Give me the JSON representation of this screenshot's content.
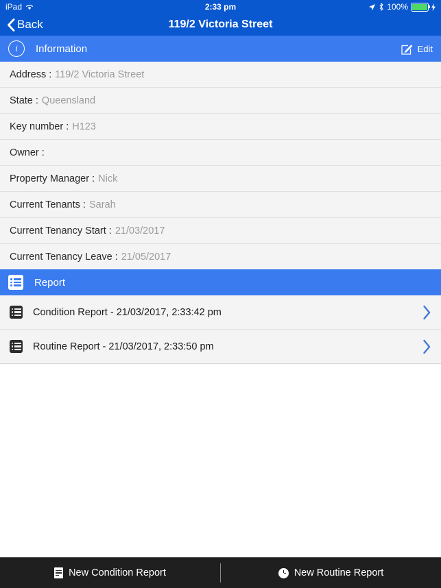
{
  "status_bar": {
    "device": "iPad",
    "wifi_icon": "wifi-icon",
    "time": "2:33 pm",
    "location_icon": "location-arrow-icon",
    "bluetooth_icon": "bluetooth-icon",
    "battery_percent": "100%",
    "battery_icon": "battery-charging-icon"
  },
  "nav_bar": {
    "back_label": "Back",
    "back_icon": "chevron-left-icon",
    "title": "119/2 Victoria Street"
  },
  "information_section": {
    "icon": "info-circle-icon",
    "title": "Information",
    "edit_label": "Edit",
    "edit_icon": "edit-pencil-square-icon",
    "rows": [
      {
        "label": "Address :",
        "value": "119/2 Victoria Street"
      },
      {
        "label": "State :",
        "value": "Queensland"
      },
      {
        "label": "Key number :",
        "value": "H123"
      },
      {
        "label": "Owner :",
        "value": ""
      },
      {
        "label": "Property Manager :",
        "value": "Nick"
      },
      {
        "label": "Current Tenants :",
        "value": "Sarah"
      },
      {
        "label": "Current Tenancy Start :",
        "value": "21/03/2017"
      },
      {
        "label": "Current Tenancy Leave :",
        "value": "21/05/2017"
      }
    ]
  },
  "report_section": {
    "icon": "list-icon",
    "title": "Report",
    "rows": [
      {
        "icon": "report-list-icon",
        "label": "Condition Report - 21/03/2017, 2:33:42 pm",
        "chevron": "chevron-right-icon"
      },
      {
        "icon": "report-list-icon",
        "label": "Routine Report - 21/03/2017, 2:33:50 pm",
        "chevron": "chevron-right-icon"
      }
    ]
  },
  "toolbar": {
    "new_condition_label": "New Condition Report",
    "new_condition_icon": "document-icon",
    "new_routine_label": "New Routine Report",
    "new_routine_icon": "clock-icon"
  },
  "colors": {
    "nav_blue": "#0A58D0",
    "header_blue": "#3B7BF0",
    "row_bg": "#F4F4F4",
    "chevron_blue": "#4179D6",
    "toolbar_bg": "#1F1F1F",
    "battery_green": "#4CD964"
  }
}
